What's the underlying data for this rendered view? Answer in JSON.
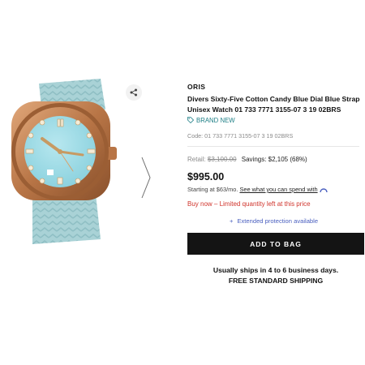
{
  "product": {
    "brand": "ORIS",
    "title": "Divers Sixty-Five Cotton Candy Blue Dial Blue Strap Unisex Watch 01 733 7771 3155-07 3 19 02BRS",
    "condition": "BRAND NEW",
    "code": "Code: 01 733 7771 3155-07 3 19 02BRS"
  },
  "pricing": {
    "retail_label": "Retail:",
    "retail_price": "$3,100.00",
    "savings": "Savings: $2,105 (68%)",
    "price": "$995.00",
    "financing_text": "Starting at $63/mo.",
    "financing_link": "See what you can spend with",
    "urgency": "Buy now – Limited quantity left at this price"
  },
  "actions": {
    "protection": "Extended protection available",
    "add_to_bag": "ADD TO BAG"
  },
  "shipping": {
    "line1": "Usually ships in 4 to 6 business days.",
    "line2": "FREE STANDARD SHIPPING"
  },
  "icons": {
    "share": "share-icon",
    "tag": "tag-icon",
    "next": "chevron-right-icon",
    "plus": "plus-icon",
    "affirm": "affirm-logo-icon"
  },
  "colors": {
    "accent_teal": "#1e7f86",
    "urgent_red": "#d0342c",
    "link_blue": "#4a5fbf",
    "button_black": "#141414"
  }
}
